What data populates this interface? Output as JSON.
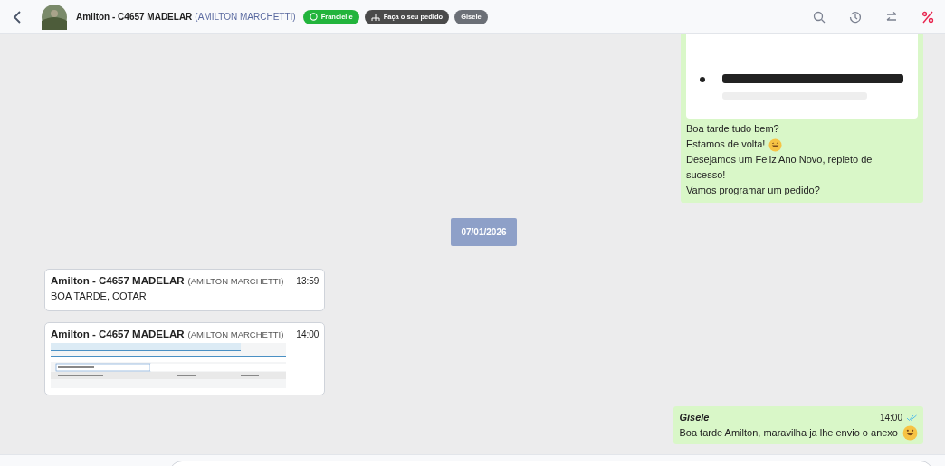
{
  "header": {
    "contact_name": "Amilton - C4657 MADELAR",
    "contact_alias": "(AMILTON MARCHETTI)",
    "tags": [
      {
        "label": "Francielle",
        "kind": "whatsapp",
        "color": "#22b43c"
      },
      {
        "label": "Faça o seu pedido",
        "kind": "flow",
        "color": "#4a4a4a"
      },
      {
        "label": "Gisele",
        "kind": "plain",
        "color": "#6b6f76"
      }
    ]
  },
  "messages": [
    {
      "kind": "outgoing",
      "attachment": {
        "kind": "picture"
      },
      "lines": [
        {
          "text": "Boa tarde tudo bem?",
          "emoji": false
        },
        {
          "text": "Estamos de volta!",
          "emoji": true
        },
        {
          "text": "Desejamos um Feliz Ano Novo, repleto de sucesso!",
          "emoji": false
        },
        {
          "text": "Vamos programar um pedido?",
          "emoji": false
        }
      ]
    },
    {
      "kind": "date",
      "text": "07/01/2026"
    },
    {
      "kind": "incoming",
      "sender": "Amilton - C4657 MADELAR",
      "alias": "(AMILTON MARCHETTI)",
      "time": "13:59",
      "text": "BOA TARDE, COTAR"
    },
    {
      "kind": "incoming",
      "sender": "Amilton - C4657 MADELAR",
      "alias": "(AMILTON MARCHETTI)",
      "time": "14:00",
      "attachment": {
        "kind": "screenshot"
      }
    },
    {
      "kind": "outgoing",
      "sender": "Gisele",
      "time": "14:00",
      "read": true,
      "text": "Boa tarde Amilton, maravilha ja lhe envio o anexo",
      "emoji": true
    }
  ]
}
